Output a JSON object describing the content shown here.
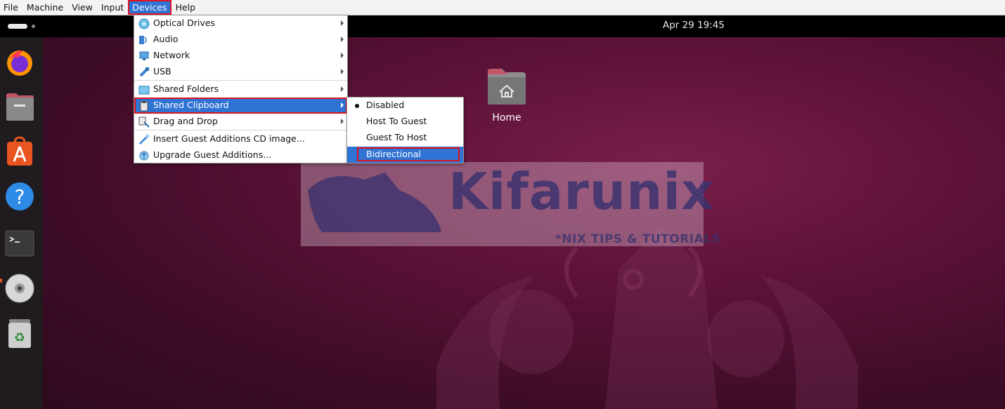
{
  "menubar": {
    "items": [
      {
        "label": "File"
      },
      {
        "label": "Machine"
      },
      {
        "label": "View"
      },
      {
        "label": "Input"
      },
      {
        "label": "Devices"
      },
      {
        "label": "Help"
      }
    ]
  },
  "topbar": {
    "clock": "Apr 29  19:45"
  },
  "desktop": {
    "home_label": "Home",
    "watermark_text": "Kifarunix",
    "watermark_subtitle": "*NIX TIPS & TUTORIALS"
  },
  "devices_menu": {
    "items": [
      {
        "label": "Optical Drives",
        "icon": "disc-icon"
      },
      {
        "label": "Audio",
        "icon": "audio-icon"
      },
      {
        "label": "Network",
        "icon": "network-icon"
      },
      {
        "label": "USB",
        "icon": "usb-icon"
      },
      {
        "label": "Shared Folders",
        "icon": "folder-icon"
      },
      {
        "label": "Shared Clipboard",
        "icon": "clipboard-icon"
      },
      {
        "label": "Drag and Drop",
        "icon": "drag-drop-icon"
      },
      {
        "label": "Insert Guest Additions CD image...",
        "icon": "cd-insert-icon"
      },
      {
        "label": "Upgrade Guest Additions...",
        "icon": "upgrade-icon"
      }
    ]
  },
  "clipboard_submenu": {
    "items": [
      {
        "label": "Disabled",
        "selected": true
      },
      {
        "label": "Host To Guest"
      },
      {
        "label": "Guest To Host"
      },
      {
        "label": "Bidirectional"
      }
    ]
  },
  "colors": {
    "accent": "#2f73d4",
    "highlight_border": "#e0141e",
    "ubuntu_orange": "#e95420"
  }
}
